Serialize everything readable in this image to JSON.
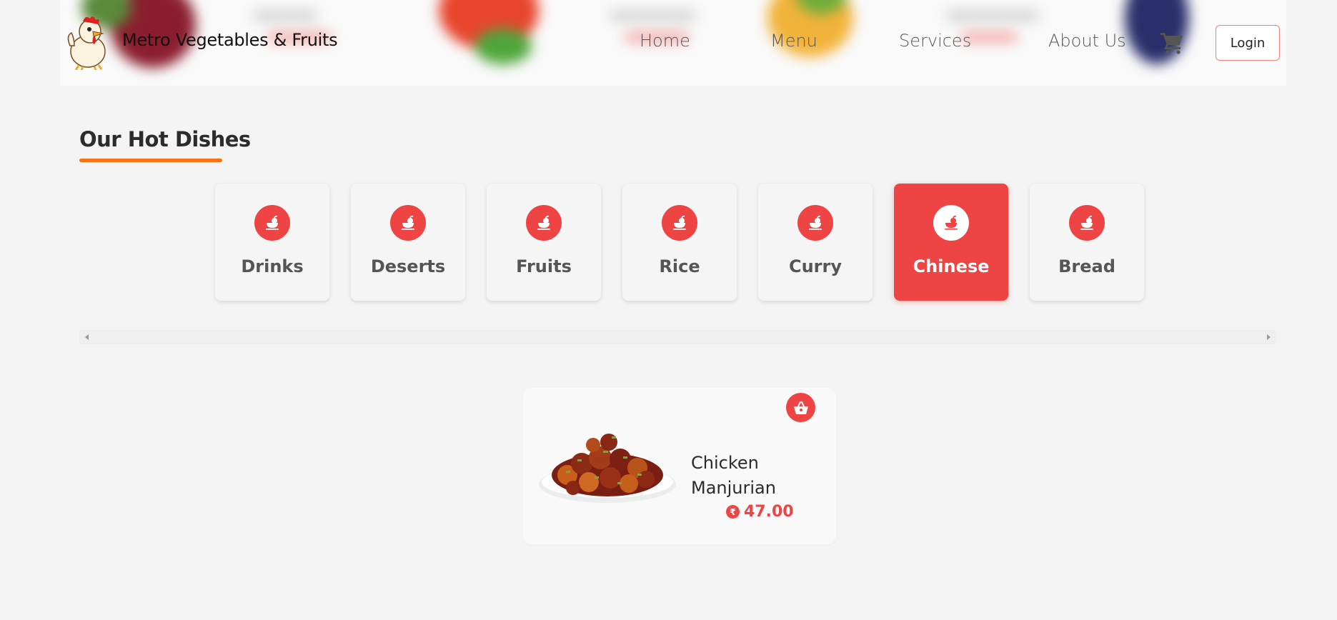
{
  "header": {
    "brand": "Metro Vegetables & Fruits",
    "nav": [
      {
        "label": "Home"
      },
      {
        "label": "Menu"
      },
      {
        "label": "Services"
      },
      {
        "label": "About Us"
      }
    ],
    "cart_icon": "shopping-cart-icon",
    "login_label": "Login"
  },
  "section": {
    "title": "Our Hot Dishes",
    "underline_color": "#f97316"
  },
  "categories": [
    {
      "label": "Drinks",
      "icon": "dish-icon",
      "active": false
    },
    {
      "label": "Deserts",
      "icon": "dish-icon",
      "active": false
    },
    {
      "label": "Fruits",
      "icon": "dish-icon",
      "active": false
    },
    {
      "label": "Rice",
      "icon": "dish-icon",
      "active": false
    },
    {
      "label": "Curry",
      "icon": "dish-icon",
      "active": false
    },
    {
      "label": "Chinese",
      "icon": "dish-icon",
      "active": true
    },
    {
      "label": "Bread",
      "icon": "dish-icon",
      "active": false
    }
  ],
  "dishes": [
    {
      "name": "Chicken Manjurian",
      "currency_symbol": "₹",
      "price": "47.00",
      "action_icon": "shopping-basket-icon"
    }
  ],
  "colors": {
    "accent": "#ef4444",
    "background": "#f4f4f4"
  }
}
